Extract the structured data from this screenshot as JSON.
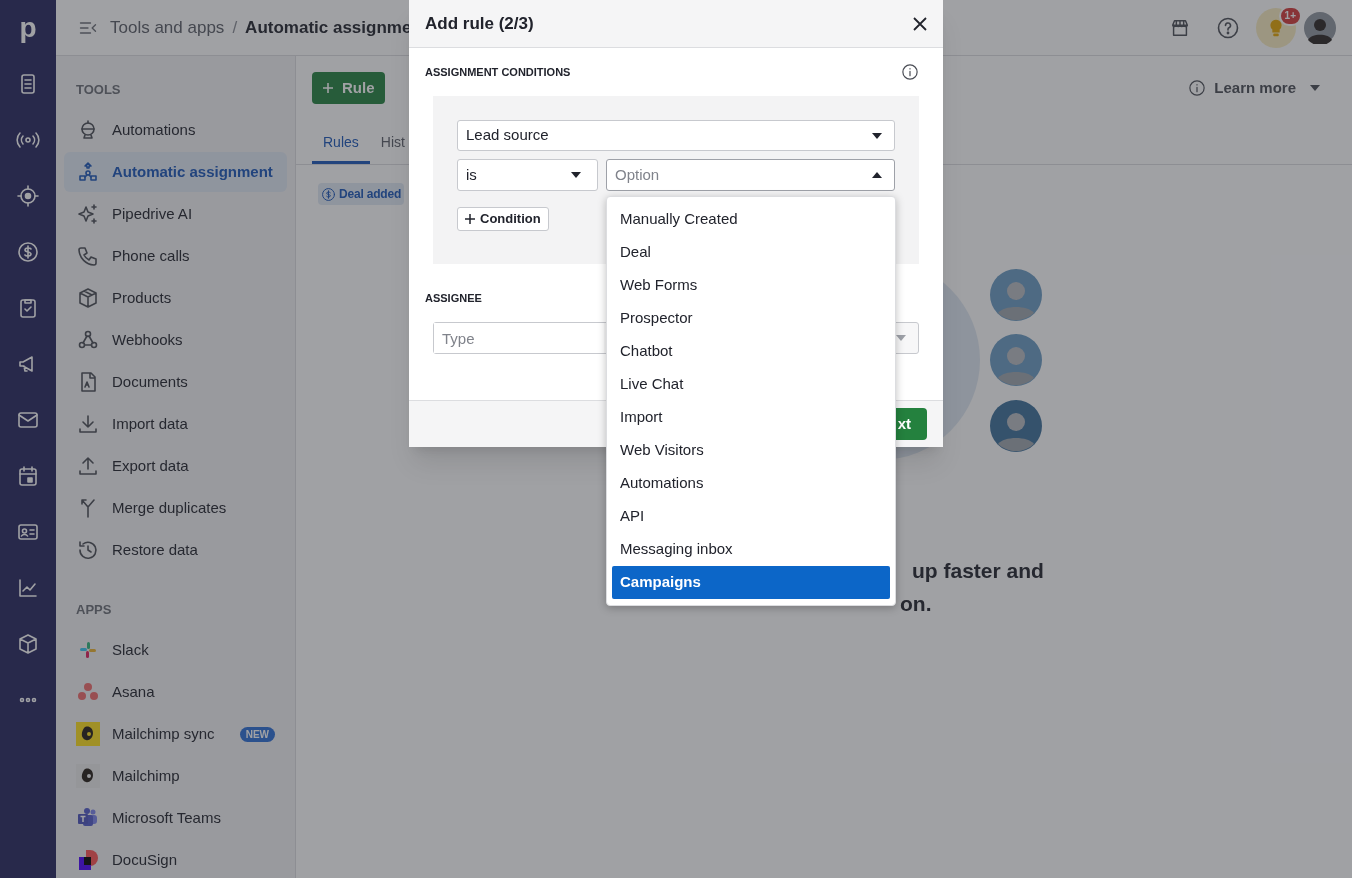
{
  "rail": {
    "logo": "p"
  },
  "header": {
    "parent": "Tools and apps",
    "separator": "/",
    "current": "Automatic assignme",
    "notification_count": "1+"
  },
  "sidebar": {
    "sections": [
      {
        "title": "TOOLS",
        "items": [
          {
            "label": "Automations",
            "selected": false
          },
          {
            "label": "Automatic assignment",
            "selected": true
          },
          {
            "label": "Pipedrive AI",
            "selected": false
          },
          {
            "label": "Phone calls",
            "selected": false
          },
          {
            "label": "Products",
            "selected": false
          },
          {
            "label": "Webhooks",
            "selected": false
          },
          {
            "label": "Documents",
            "selected": false
          },
          {
            "label": "Import data",
            "selected": false
          },
          {
            "label": "Export data",
            "selected": false
          },
          {
            "label": "Merge duplicates",
            "selected": false
          },
          {
            "label": "Restore data",
            "selected": false
          }
        ]
      },
      {
        "title": "APPS",
        "items": [
          {
            "label": "Slack",
            "selected": false
          },
          {
            "label": "Asana",
            "selected": false
          },
          {
            "label": "Mailchimp sync",
            "selected": false,
            "badge": "NEW"
          },
          {
            "label": "Mailchimp",
            "selected": false
          },
          {
            "label": "Microsoft Teams",
            "selected": false
          },
          {
            "label": "DocuSign",
            "selected": false
          }
        ]
      }
    ]
  },
  "main": {
    "add_button": "Rule",
    "tabs": [
      {
        "label": "Rules",
        "selected": true
      },
      {
        "label": "Hist",
        "selected": false
      }
    ],
    "trigger_tag": "Deal added",
    "learn_more": "Learn more",
    "headline": [
      "up faster and",
      "on."
    ]
  },
  "modal": {
    "title": "Add rule (2/3)",
    "conditions_title": "ASSIGNMENT CONDITIONS",
    "field": "Lead source",
    "operator": "is",
    "value": {
      "placeholder": "Option",
      "expanded": true
    },
    "add_condition": "Condition",
    "assignee_title": "ASSIGNEE",
    "assignee": {
      "placeholder": "Type"
    },
    "next_button": "xt",
    "options": [
      {
        "label": "Manually Created",
        "selected": false
      },
      {
        "label": "Deal",
        "selected": false
      },
      {
        "label": "Web Forms",
        "selected": false
      },
      {
        "label": "Prospector",
        "selected": false
      },
      {
        "label": "Chatbot",
        "selected": false
      },
      {
        "label": "Live Chat",
        "selected": false
      },
      {
        "label": "Import",
        "selected": false
      },
      {
        "label": "Web Visitors",
        "selected": false
      },
      {
        "label": "Automations",
        "selected": false
      },
      {
        "label": "API",
        "selected": false
      },
      {
        "label": "Messaging inbox",
        "selected": false
      },
      {
        "label": "Campaigns",
        "selected": true
      }
    ]
  }
}
